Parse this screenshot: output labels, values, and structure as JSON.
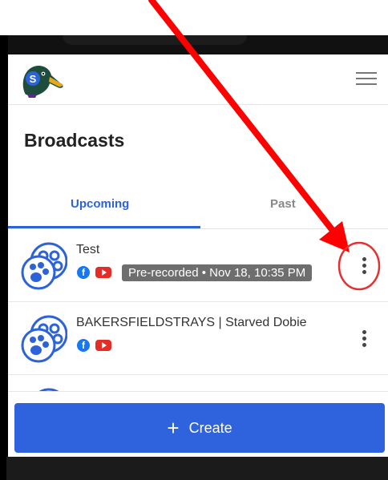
{
  "page": {
    "title": "Broadcasts"
  },
  "tabs": [
    {
      "label": "Upcoming"
    },
    {
      "label": "Past"
    }
  ],
  "broadcasts": [
    {
      "title": "Test",
      "status": "Pre-recorded • Nov 18, 10:35 PM"
    },
    {
      "title": "BAKERSFIELDSTRAYS | Starved Dobie",
      "status": ""
    }
  ],
  "create_button": {
    "label": "Create"
  },
  "icons": {
    "logo": "duck-logo-icon",
    "menu": "hamburger-menu-icon",
    "broadcast": "paw-icon",
    "facebook": "facebook-icon",
    "youtube": "youtube-icon",
    "more": "kebab-menu-icon",
    "add": "plus-icon"
  },
  "colors": {
    "accent": "#2c63d8",
    "create_button": "#2f62dd",
    "annotation_arrow": "#ff0000",
    "annotation_circle": "#e53030"
  }
}
